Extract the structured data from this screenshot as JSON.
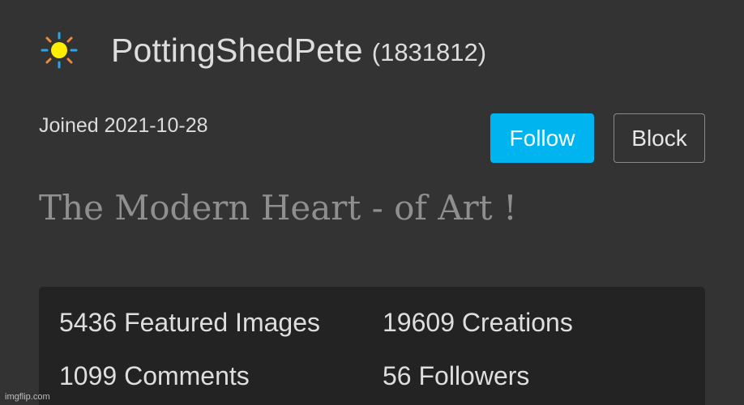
{
  "profile": {
    "username": "PottingShedPete",
    "user_id": "(1831812)",
    "avatar_icon": "sun-icon",
    "joined": "Joined 2021-10-28",
    "tagline": "The Modern Heart - of Art !"
  },
  "actions": {
    "follow_label": "Follow",
    "block_label": "Block"
  },
  "stats": {
    "featured_images": "5436 Featured Images",
    "creations": "19609 Creations",
    "comments": "1099 Comments",
    "followers": "56 Followers"
  },
  "watermark": "imgflip.com",
  "colors": {
    "background": "#333333",
    "accent": "#00b4ef",
    "stats_panel": "#232323",
    "sun_core": "#ffee00",
    "sun_rays_blue": "#2aa6e8",
    "sun_rays_orange": "#ef8a3a"
  }
}
